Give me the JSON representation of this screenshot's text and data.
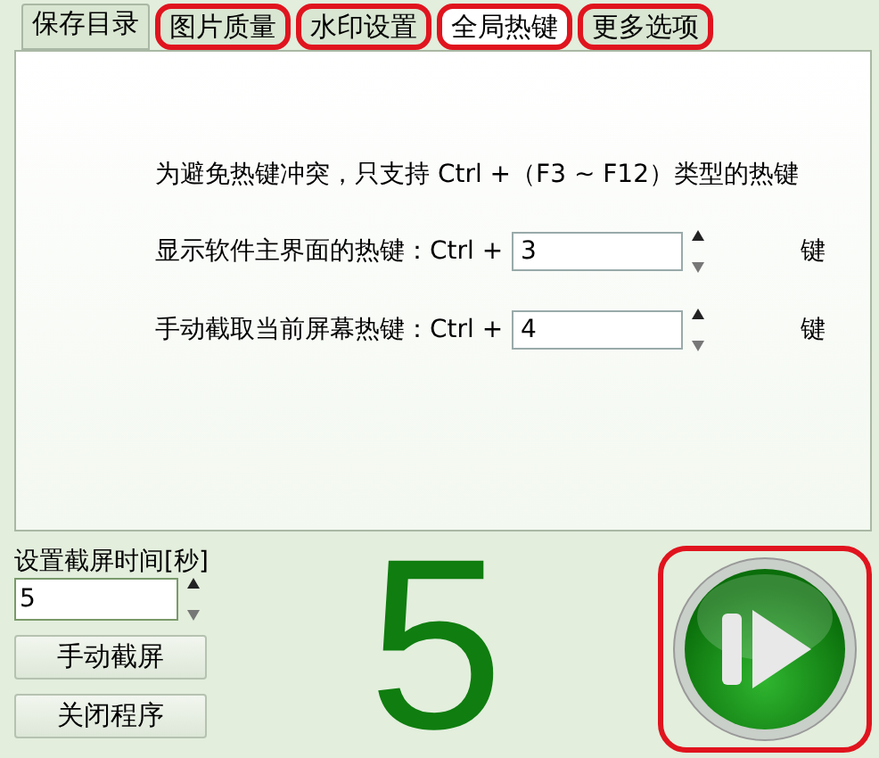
{
  "tabs": [
    {
      "label": "保存目录",
      "selected": false,
      "highlighted": false
    },
    {
      "label": "图片质量",
      "selected": false,
      "highlighted": true
    },
    {
      "label": "水印设置",
      "selected": false,
      "highlighted": true
    },
    {
      "label": "全局热键",
      "selected": true,
      "highlighted": true
    },
    {
      "label": "更多选项",
      "selected": false,
      "highlighted": true
    }
  ],
  "panel": {
    "note": "为避免热键冲突，只支持 Ctrl +（F3 ~ F12）类型的热键",
    "hotkeys": [
      {
        "label": "显示软件主界面的热键：Ctrl +",
        "value": "3",
        "suffix": "键"
      },
      {
        "label": "手动截取当前屏幕热键：Ctrl +",
        "value": "4",
        "suffix": "键"
      }
    ]
  },
  "timer": {
    "label": "设置截屏时间[秒]",
    "value": "5"
  },
  "buttons": [
    "手动截屏",
    "关闭程序"
  ],
  "countdown": "5",
  "play_button": {
    "highlighted": true
  }
}
